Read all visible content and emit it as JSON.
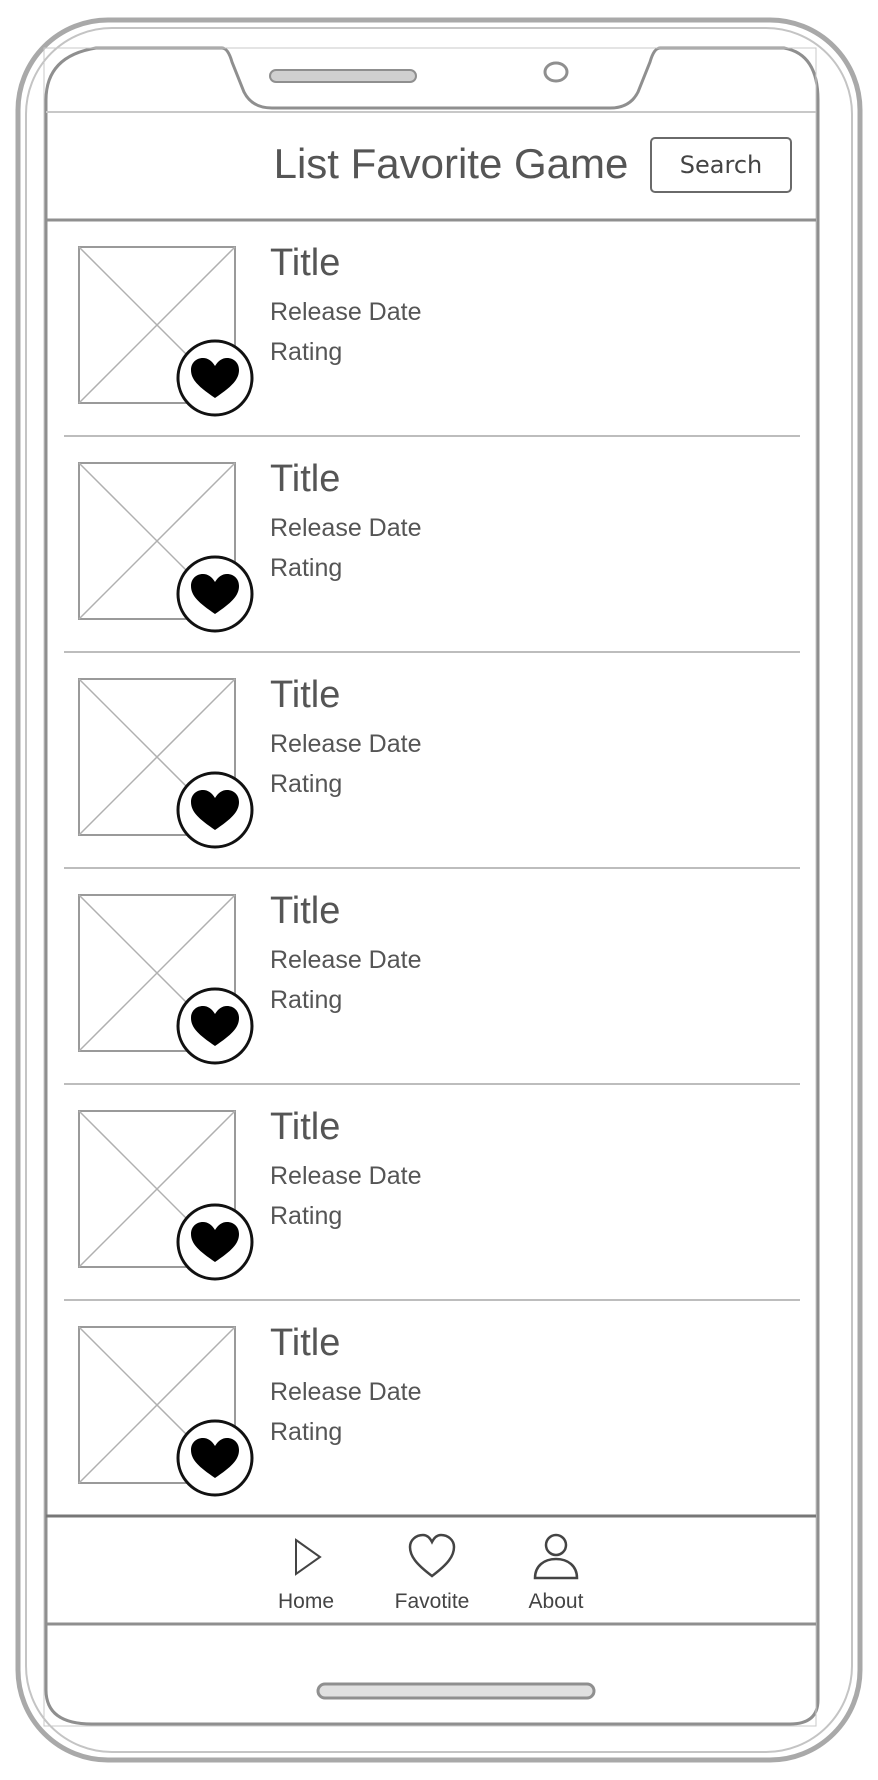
{
  "header": {
    "title": "List Favorite Game",
    "search_label": "Search"
  },
  "games": [
    {
      "title": "Title",
      "release_date": "Release Date",
      "rating": "Rating"
    },
    {
      "title": "Title",
      "release_date": "Release Date",
      "rating": "Rating"
    },
    {
      "title": "Title",
      "release_date": "Release Date",
      "rating": "Rating"
    },
    {
      "title": "Title",
      "release_date": "Release Date",
      "rating": "Rating"
    },
    {
      "title": "Title",
      "release_date": "Release Date",
      "rating": "Rating"
    },
    {
      "title": "Title",
      "release_date": "Release Date",
      "rating": "Rating"
    }
  ],
  "bottom_nav": {
    "items": [
      {
        "label": "Home",
        "icon": "play-icon"
      },
      {
        "label": "Favotite",
        "icon": "heart-icon"
      },
      {
        "label": "About",
        "icon": "user-icon"
      }
    ]
  },
  "colors": {
    "frame": "#a9a9a9",
    "text": "#555555",
    "divider": "#bdbdbd",
    "heart": "#000000"
  }
}
